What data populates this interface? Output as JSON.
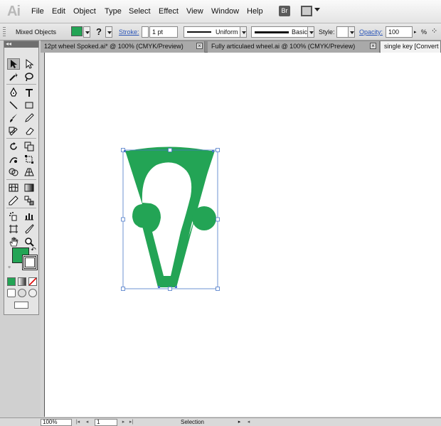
{
  "app": {
    "logo": "Ai"
  },
  "menu": [
    "File",
    "Edit",
    "Object",
    "Type",
    "Select",
    "Effect",
    "View",
    "Window",
    "Help"
  ],
  "bridge_button": "Br",
  "control_bar": {
    "selection_label": "Mixed Objects",
    "fill_color": "#23a455",
    "fill_question": "?",
    "stroke_label": "Stroke:",
    "stroke_weight": "1 pt",
    "profile_label": "Uniform",
    "brush_label": "Basic",
    "style_label": "Style:",
    "opacity_label": "Opacity:",
    "opacity_value": "100",
    "percent": "%"
  },
  "tabs": [
    {
      "label": "12pt wheel  Spoked.ai* @ 100% (CMYK/Preview)",
      "active": false
    },
    {
      "label": "Fully articulaed wheel.ai @ 100% (CMYK/Preview)",
      "active": false
    },
    {
      "label": "single key [Convert",
      "active": true
    }
  ],
  "colors": {
    "shape_fill": "#23a455",
    "selection": "#4a78c8"
  },
  "status_bar": {
    "zoom": "100%",
    "page": "1",
    "tool_label": "Selection"
  }
}
